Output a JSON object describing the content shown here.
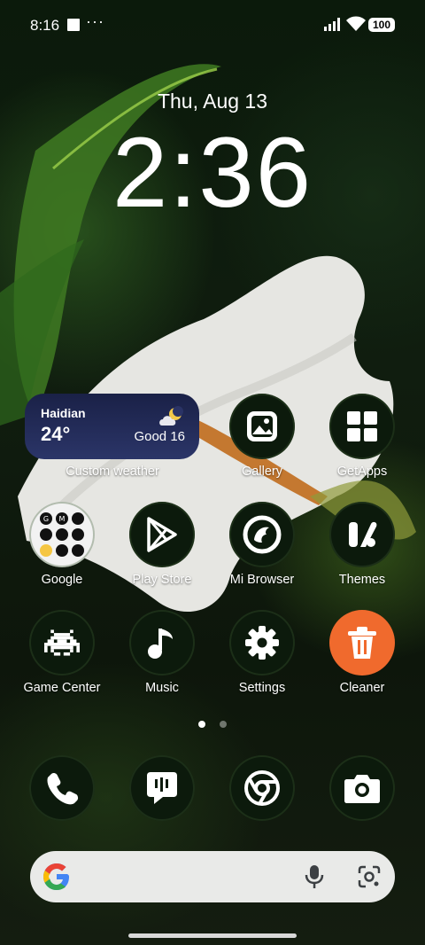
{
  "status_bar": {
    "time": "8:16",
    "more": "···",
    "battery": "100"
  },
  "lock_clock": {
    "date": "Thu, Aug 13",
    "time": "2:36"
  },
  "weather_widget": {
    "city": "Haidian",
    "temperature": "24°",
    "air_quality": "Good 16",
    "label": "Custom weather",
    "icon": "partly-cloudy-night-icon"
  },
  "apps": {
    "gallery": "Gallery",
    "getapps": "GetApps",
    "google": "Google",
    "play_store": "Play Store",
    "mi_browser": "Mi Browser",
    "themes": "Themes",
    "game_center": "Game Center",
    "music": "Music",
    "settings": "Settings",
    "cleaner": "Cleaner"
  },
  "dock": [
    "phone-icon",
    "messages-icon",
    "chrome-icon",
    "camera-icon"
  ],
  "pager": {
    "pages": 2,
    "current": 1
  },
  "colors": {
    "cleaner_accent": "#f06a2d",
    "weather_bg": "#1f2852",
    "icon_bg": "#0c1a0c"
  }
}
